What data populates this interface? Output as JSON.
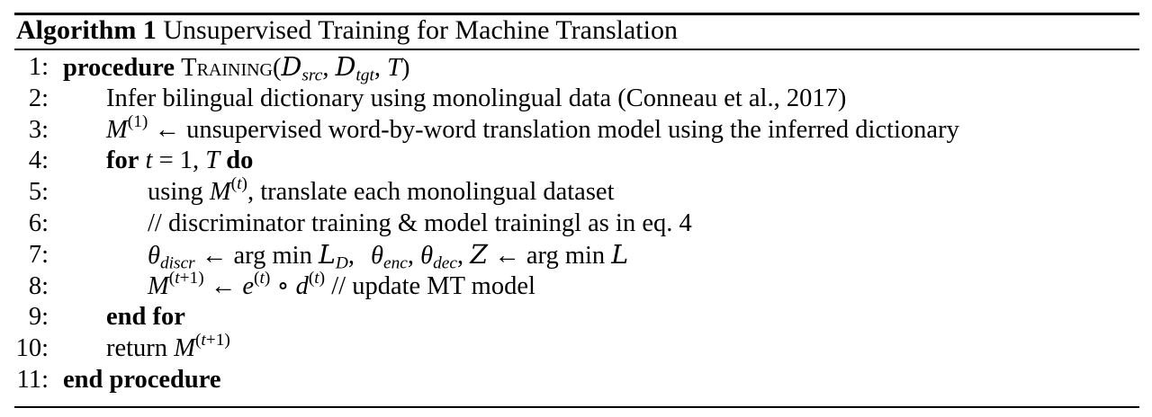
{
  "algorithm": {
    "label": "Algorithm 1",
    "title": "Unsupervised Training for Machine Translation"
  },
  "lines": [
    {
      "number": "1:"
    },
    {
      "number": "2:",
      "text": "Infer bilingual dictionary using monolingual data (Conneau et al., 2017)"
    },
    {
      "number": "3:",
      "text": "unsupervised word-by-word translation model using the inferred dictionary"
    },
    {
      "number": "4:"
    },
    {
      "number": "5:",
      "text_before": "using",
      "text_after": ", translate each monolingual dataset"
    },
    {
      "number": "6:",
      "text": "// discriminator training & model trainingl as in eq. 4"
    },
    {
      "number": "7:"
    },
    {
      "number": "8:",
      "text": "// update MT model"
    },
    {
      "number": "9:"
    },
    {
      "number": "10:",
      "text": "return"
    },
    {
      "number": "11:"
    }
  ],
  "keywords": {
    "procedure": "procedure",
    "procedure_name": "Training",
    "for": "for",
    "do": "do",
    "end_for": "end for",
    "end_procedure": "end procedure"
  }
}
